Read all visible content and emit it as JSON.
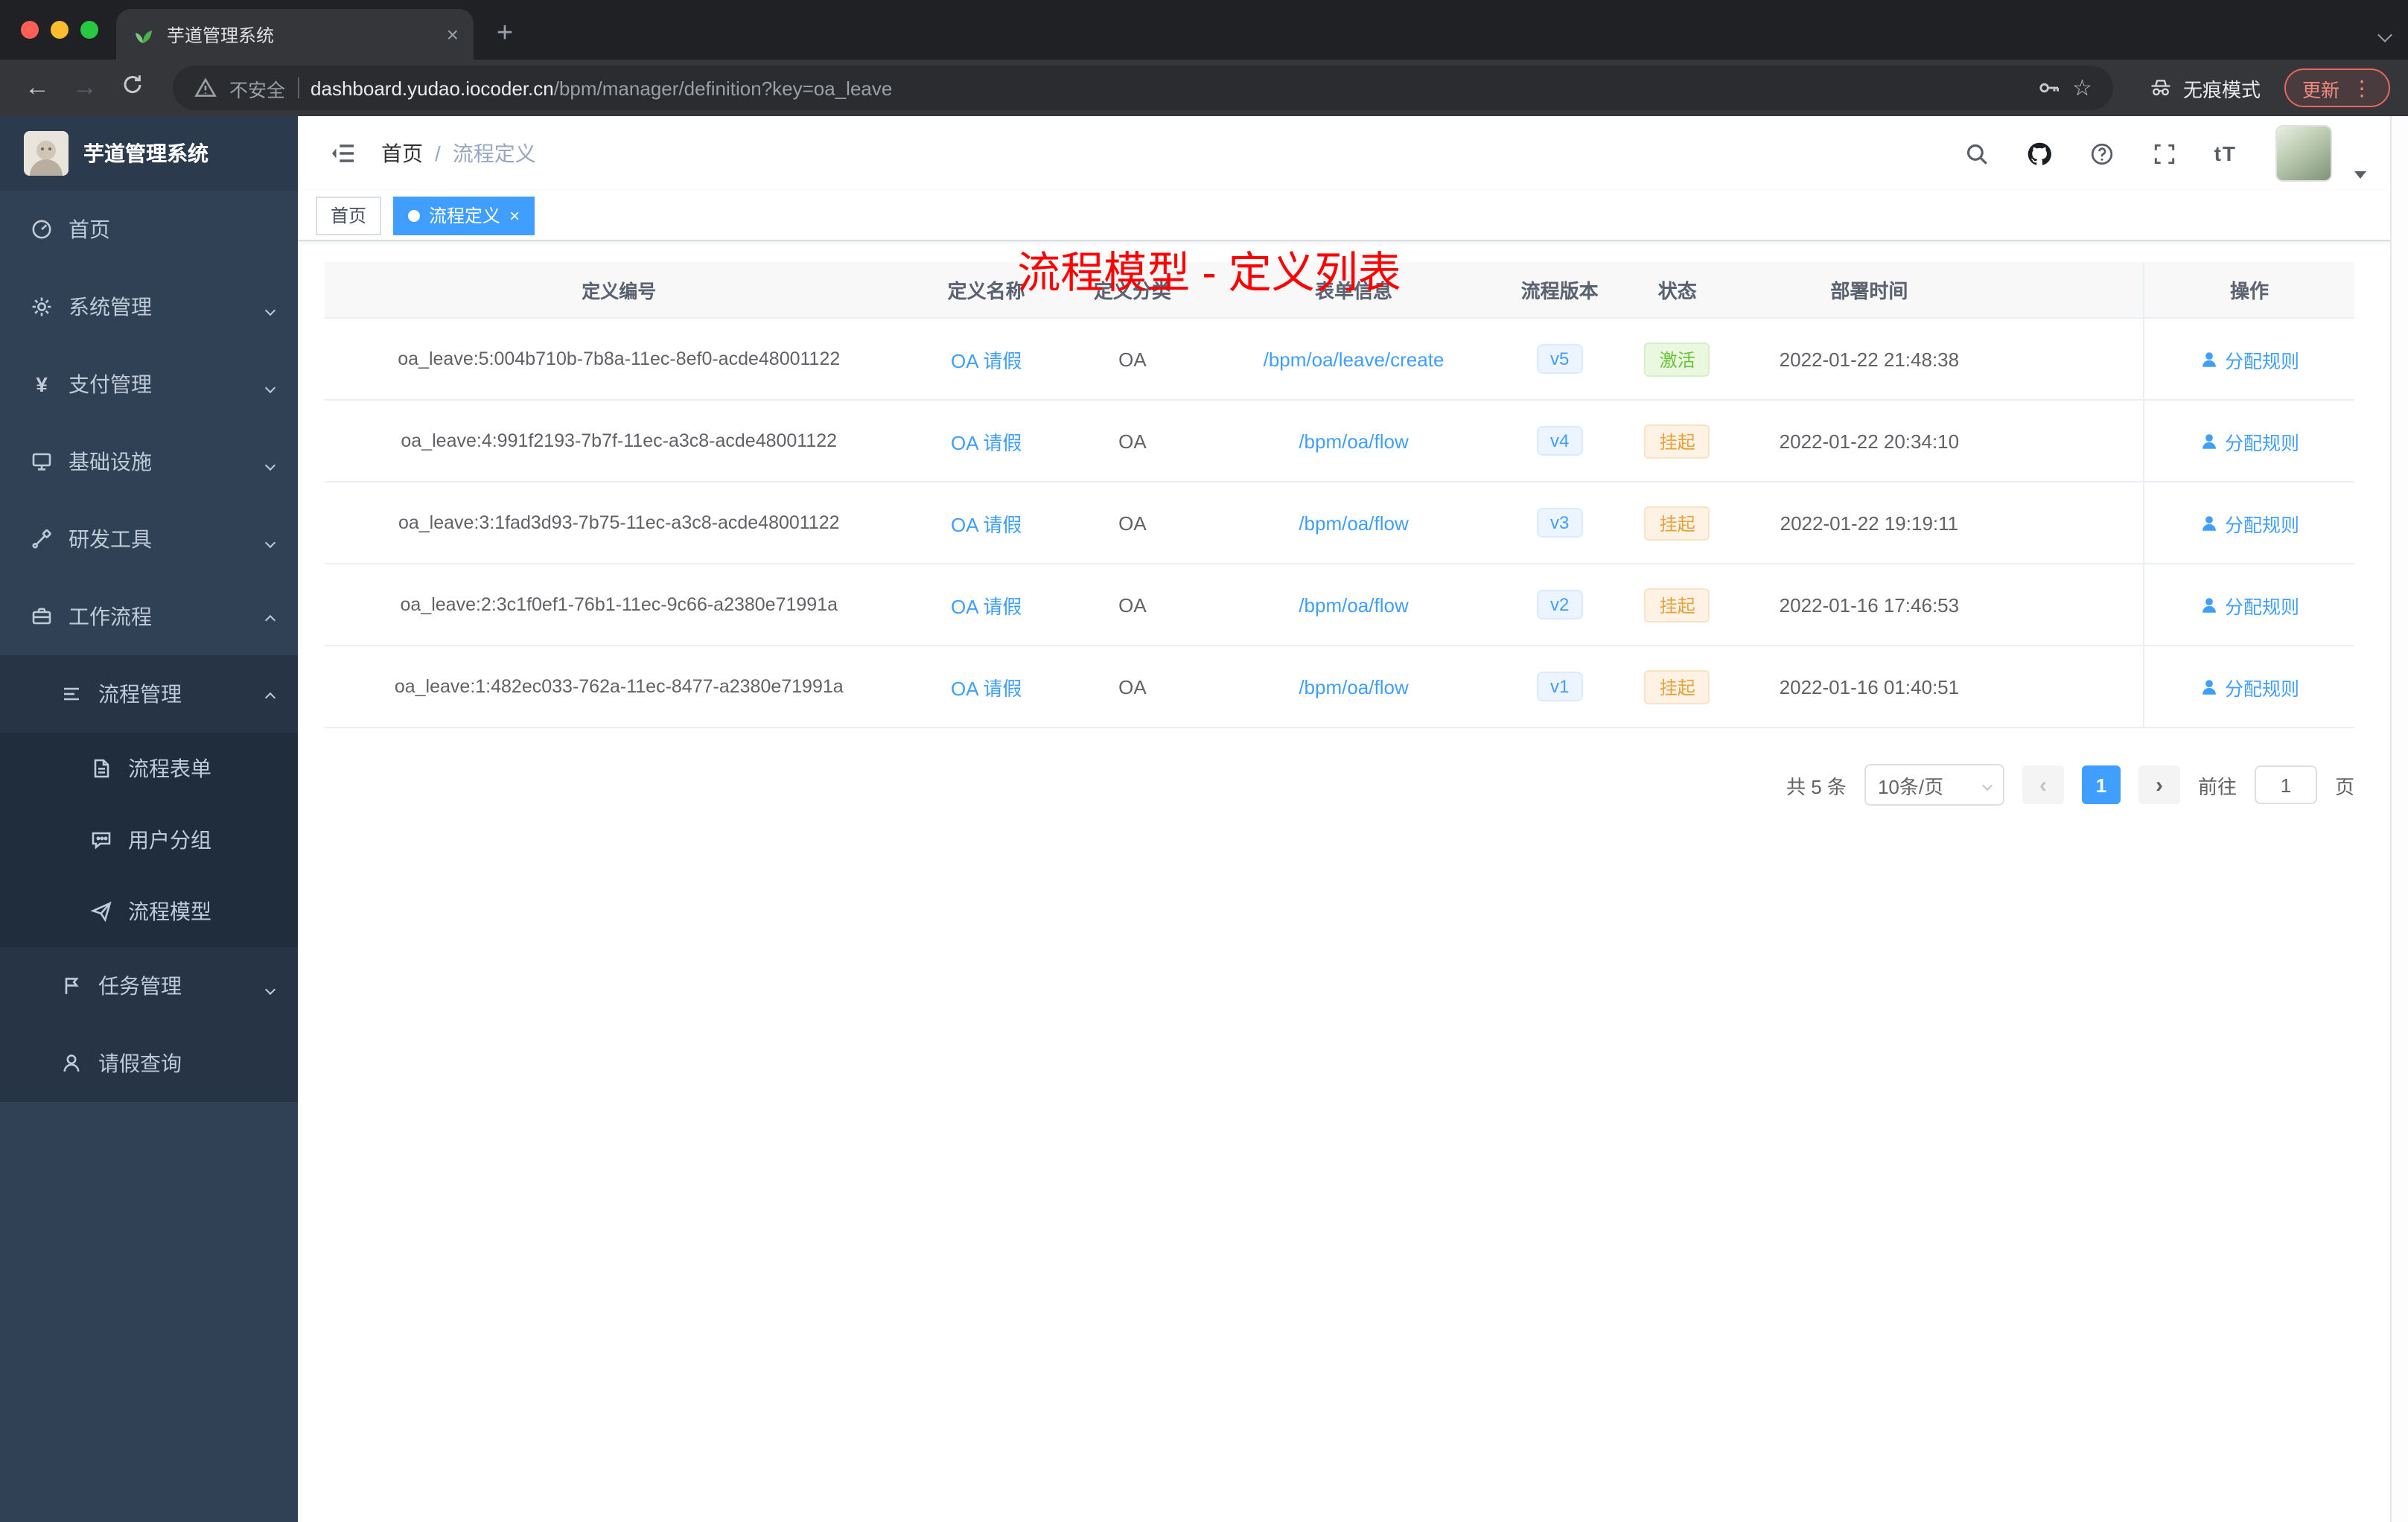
{
  "browser": {
    "tab_title": "芋道管理系统",
    "security_label": "不安全",
    "url_host": "dashboard.yudao.iocoder.cn",
    "url_path": "/bpm/manager/definition?key=oa_leave",
    "incognito_label": "无痕模式",
    "update_label": "更新"
  },
  "icons": {
    "close_tab": "×",
    "new_tab": "+",
    "back": "←",
    "forward": "→",
    "star": "☆",
    "menu_dots": "⋮",
    "font_size": "tT",
    "help": "?",
    "prev": "‹",
    "next": "›",
    "tag_close": "×",
    "breadcrumb_separator": "/"
  },
  "sidebar": {
    "logo_title": "芋道管理系统",
    "items": [
      {
        "label": "首页"
      },
      {
        "label": "系统管理"
      },
      {
        "label": "支付管理"
      },
      {
        "label": "基础设施"
      },
      {
        "label": "研发工具"
      },
      {
        "label": "工作流程"
      },
      {
        "label": "流程管理"
      },
      {
        "label": "流程表单"
      },
      {
        "label": "用户分组"
      },
      {
        "label": "流程模型"
      },
      {
        "label": "任务管理"
      },
      {
        "label": "请假查询"
      }
    ]
  },
  "header": {
    "breadcrumb_home": "首页",
    "breadcrumb_current": "流程定义",
    "annotation": "流程模型 - 定义列表"
  },
  "tags": {
    "home": "首页",
    "active": "流程定义"
  },
  "table": {
    "columns": [
      "定义编号",
      "定义名称",
      "定义分类",
      "表单信息",
      "流程版本",
      "状态",
      "部署时间",
      "操作"
    ],
    "action_label": "分配规则",
    "rows": [
      {
        "id": "oa_leave:5:004b710b-7b8a-11ec-8ef0-acde48001122",
        "name": "OA 请假",
        "category": "OA",
        "form": "/bpm/oa/leave/create",
        "version": "v5",
        "status": "激活",
        "status_type": "success",
        "time": "2022-01-22 21:48:38"
      },
      {
        "id": "oa_leave:4:991f2193-7b7f-11ec-a3c8-acde48001122",
        "name": "OA 请假",
        "category": "OA",
        "form": "/bpm/oa/flow",
        "version": "v4",
        "status": "挂起",
        "status_type": "warning",
        "time": "2022-01-22 20:34:10"
      },
      {
        "id": "oa_leave:3:1fad3d93-7b75-11ec-a3c8-acde48001122",
        "name": "OA 请假",
        "category": "OA",
        "form": "/bpm/oa/flow",
        "version": "v3",
        "status": "挂起",
        "status_type": "warning",
        "time": "2022-01-22 19:19:11"
      },
      {
        "id": "oa_leave:2:3c1f0ef1-76b1-11ec-9c66-a2380e71991a",
        "name": "OA 请假",
        "category": "OA",
        "form": "/bpm/oa/flow",
        "version": "v2",
        "status": "挂起",
        "status_type": "warning",
        "time": "2022-01-16 17:46:53"
      },
      {
        "id": "oa_leave:1:482ec033-762a-11ec-8477-a2380e71991a",
        "name": "OA 请假",
        "category": "OA",
        "form": "/bpm/oa/flow",
        "version": "v1",
        "status": "挂起",
        "status_type": "warning",
        "time": "2022-01-16 01:40:51"
      }
    ]
  },
  "pagination": {
    "total": "共 5 条",
    "page_size": "10条/页",
    "current_page": "1",
    "goto_label": "前往",
    "goto_value": "1",
    "goto_unit": "页"
  },
  "colors": {
    "accent": "#409eff",
    "status_active": "#67c23a",
    "status_suspended": "#e6a23c",
    "annotation_red": "#ff0000",
    "sidebar_bg": "#304156"
  }
}
